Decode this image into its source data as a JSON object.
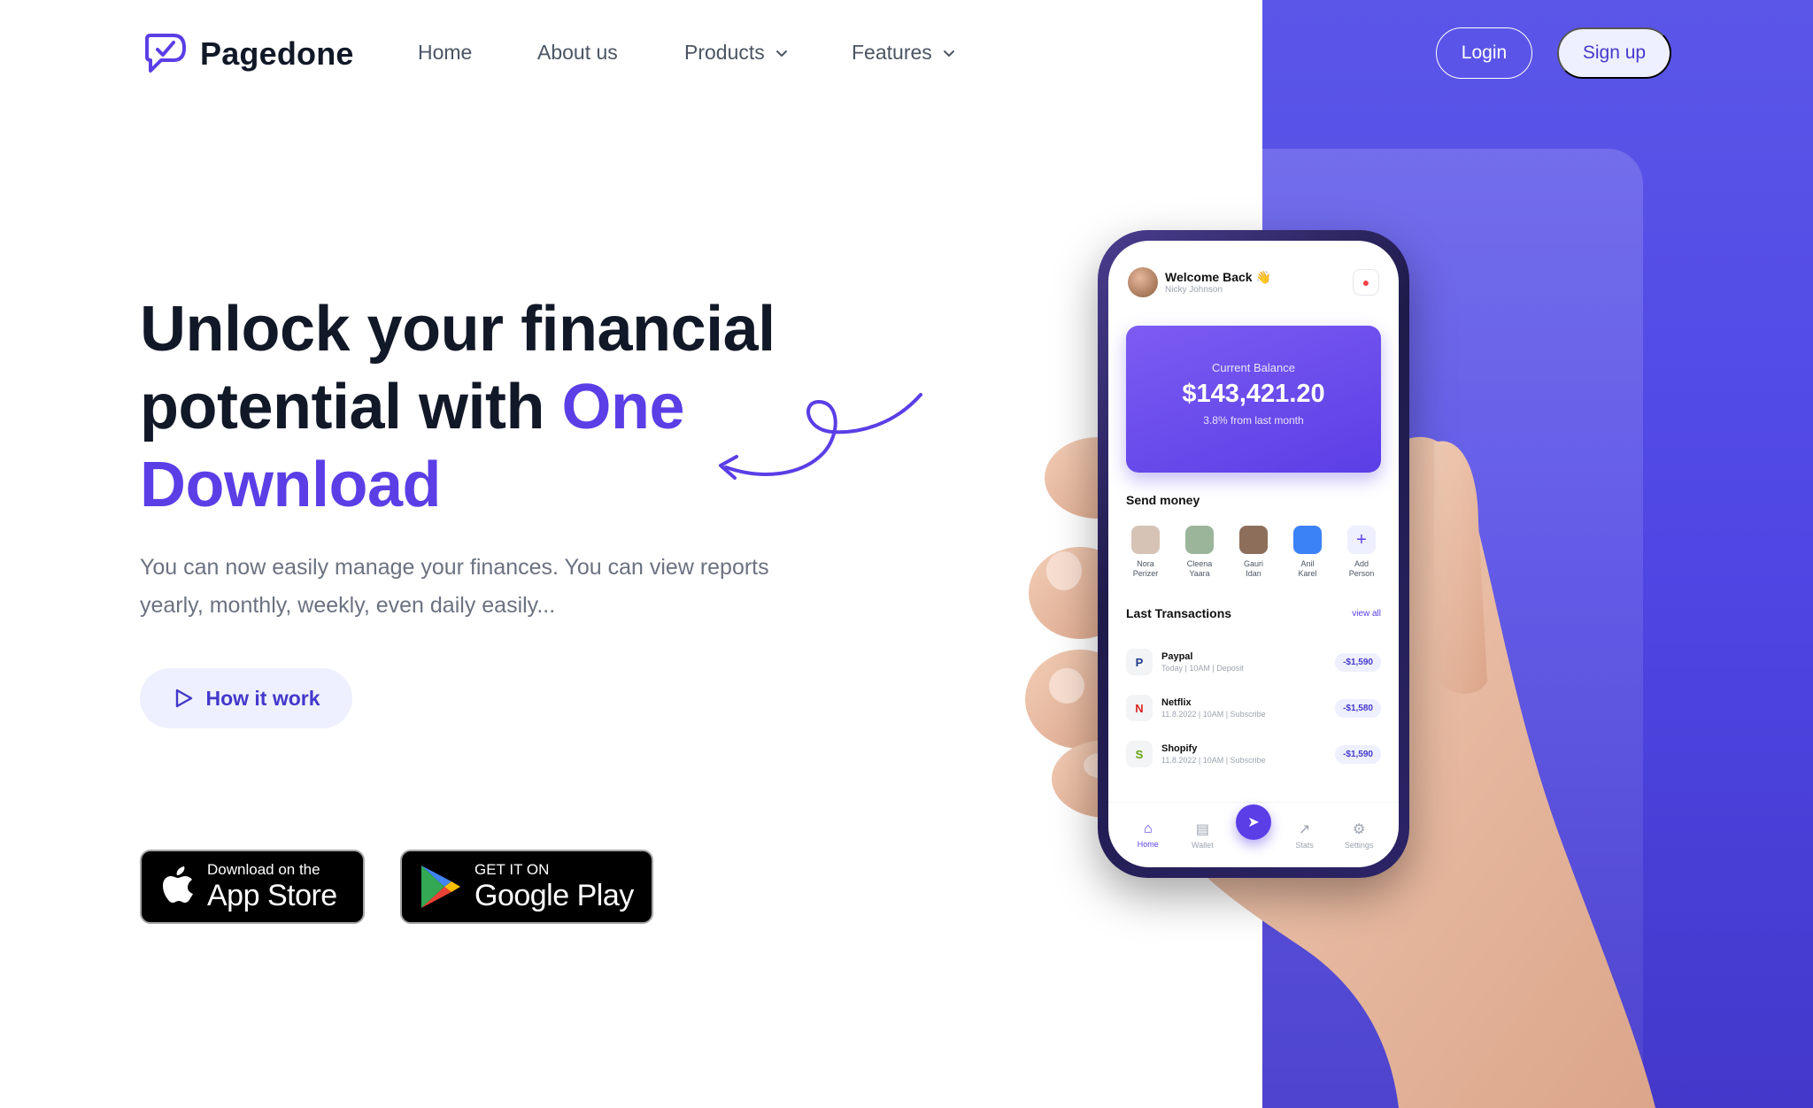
{
  "brand": {
    "name": "Pagedone",
    "accent": "#5b3ee6"
  },
  "nav": {
    "home": "Home",
    "about": "About us",
    "products": "Products",
    "features": "Features"
  },
  "auth": {
    "login": "Login",
    "signup": "Sign up"
  },
  "hero": {
    "title_line1": "Unlock your financial",
    "title_line2_start": "potential with ",
    "title_line2_accent": "One",
    "title_line3_accent": "Download",
    "description": "You can now easily manage your finances. You can view reports yearly, monthly, weekly, even daily easily...",
    "cta_label": "How it work"
  },
  "badges": {
    "apple_small": "Download on the",
    "apple_big": "App Store",
    "google_small": "GET IT ON",
    "google_big": "Google Play"
  },
  "phone": {
    "welcome": "Welcome Back 👋",
    "user": "Nicky Johnson",
    "balance_label": "Current Balance",
    "balance": "$143,421.20",
    "balance_sub": "3.8% from last month",
    "send_money": "Send money",
    "people": [
      {
        "first": "Nora",
        "last": "Perizer",
        "color": "#d6c3b5"
      },
      {
        "first": "Cleena",
        "last": "Yaara",
        "color": "#9bb59a"
      },
      {
        "first": "Gauri",
        "last": "Idan",
        "color": "#8d6e5a"
      },
      {
        "first": "Anil",
        "last": "Karel",
        "color": "#3b82f6"
      },
      {
        "first": "Add",
        "last": "Person",
        "color": "#eef0ff"
      }
    ],
    "last_transactions": "Last Transactions",
    "view_all": "view all",
    "transactions": [
      {
        "name": "Paypal",
        "meta": "Today | 10AM | Deposit",
        "amount": "-$1,590",
        "icon": "P",
        "icon_color": "#1e3a8a"
      },
      {
        "name": "Netflix",
        "meta": "11.8.2022 | 10AM | Subscribe",
        "amount": "-$1,580",
        "icon": "N",
        "icon_color": "#dc2626"
      },
      {
        "name": "Shopify",
        "meta": "11.8.2022 | 10AM | Subscribe",
        "amount": "-$1,590",
        "icon": "S",
        "icon_color": "#65a30d"
      }
    ],
    "tabs": {
      "home": "Home",
      "wallet": "Wallet",
      "stats": "Stats",
      "settings": "Settings"
    }
  }
}
